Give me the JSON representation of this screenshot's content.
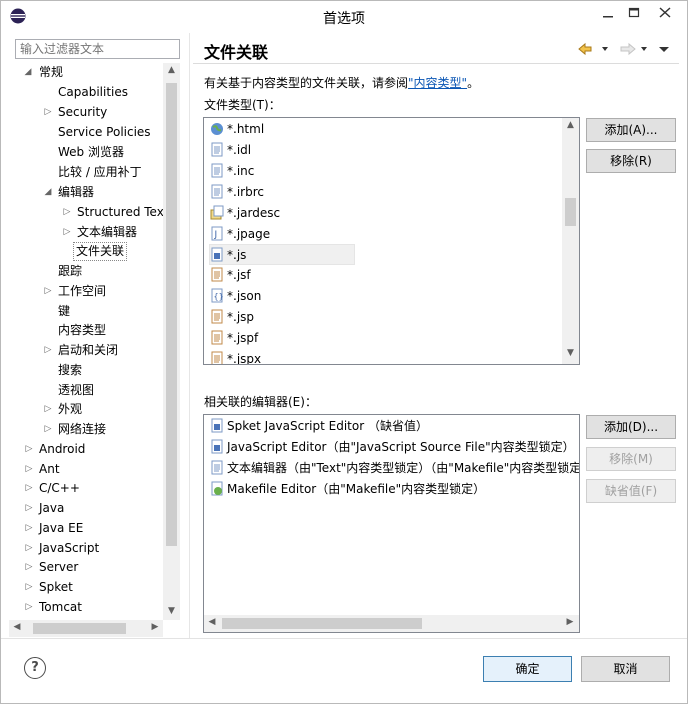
{
  "window": {
    "title": "首选项"
  },
  "filter": {
    "placeholder": "输入过滤器文本"
  },
  "tree": [
    {
      "label": "常规",
      "expanded": true
    },
    {
      "label": "Capabilities"
    },
    {
      "label": "Security"
    },
    {
      "label": "Service Policies"
    },
    {
      "label": "Web 浏览器"
    },
    {
      "label": "比较 / 应用补丁"
    },
    {
      "label": "编辑器",
      "expanded": true
    },
    {
      "label": "Structured Text"
    },
    {
      "label": "文本编辑器"
    },
    {
      "label": "文件关联",
      "selected": true
    },
    {
      "label": "跟踪"
    },
    {
      "label": "工作空间"
    },
    {
      "label": "键"
    },
    {
      "label": "内容类型"
    },
    {
      "label": "启动和关闭"
    },
    {
      "label": "搜索"
    },
    {
      "label": "透视图"
    },
    {
      "label": "外观"
    },
    {
      "label": "网络连接"
    },
    {
      "label": "Android"
    },
    {
      "label": "Ant"
    },
    {
      "label": "C/C++"
    },
    {
      "label": "Java"
    },
    {
      "label": "Java EE"
    },
    {
      "label": "JavaScript"
    },
    {
      "label": "Server"
    },
    {
      "label": "Spket"
    },
    {
      "label": "Tomcat"
    }
  ],
  "page": {
    "title": "文件关联",
    "desc_prefix": "有关基于内容类型的文件关联，请参阅",
    "desc_link": "\"内容类型\"",
    "desc_suffix": "。",
    "file_types_label": "文件类型(T)：",
    "file_types": [
      "*.html",
      "*.idl",
      "*.inc",
      "*.irbrc",
      "*.jardesc",
      "*.jpage",
      "*.js",
      "*.jsf",
      "*.json",
      "*.jsp",
      "*.jspf",
      "*.jspx"
    ],
    "selected_file_type": "*.js",
    "editors_label": "相关联的编辑器(E)：",
    "editors": [
      "Spket JavaScript Editor （缺省值）",
      "JavaScript Editor（由\"JavaScript Source File\"内容类型锁定）",
      "文本编辑器（由\"Text\"内容类型锁定）（由\"Makefile\"内容类型锁定）",
      "Makefile Editor（由\"Makefile\"内容类型锁定）"
    ]
  },
  "buttons": {
    "add_type": "添加(A)...",
    "remove_type": "移除(R)",
    "add_editor": "添加(D)...",
    "remove_editor": "移除(M)",
    "default_editor": "缺省值(F)",
    "ok": "确定",
    "cancel": "取消",
    "help": "?"
  },
  "colors": {
    "link": "#0b56b4",
    "ok_border": "#3c7fb1"
  }
}
